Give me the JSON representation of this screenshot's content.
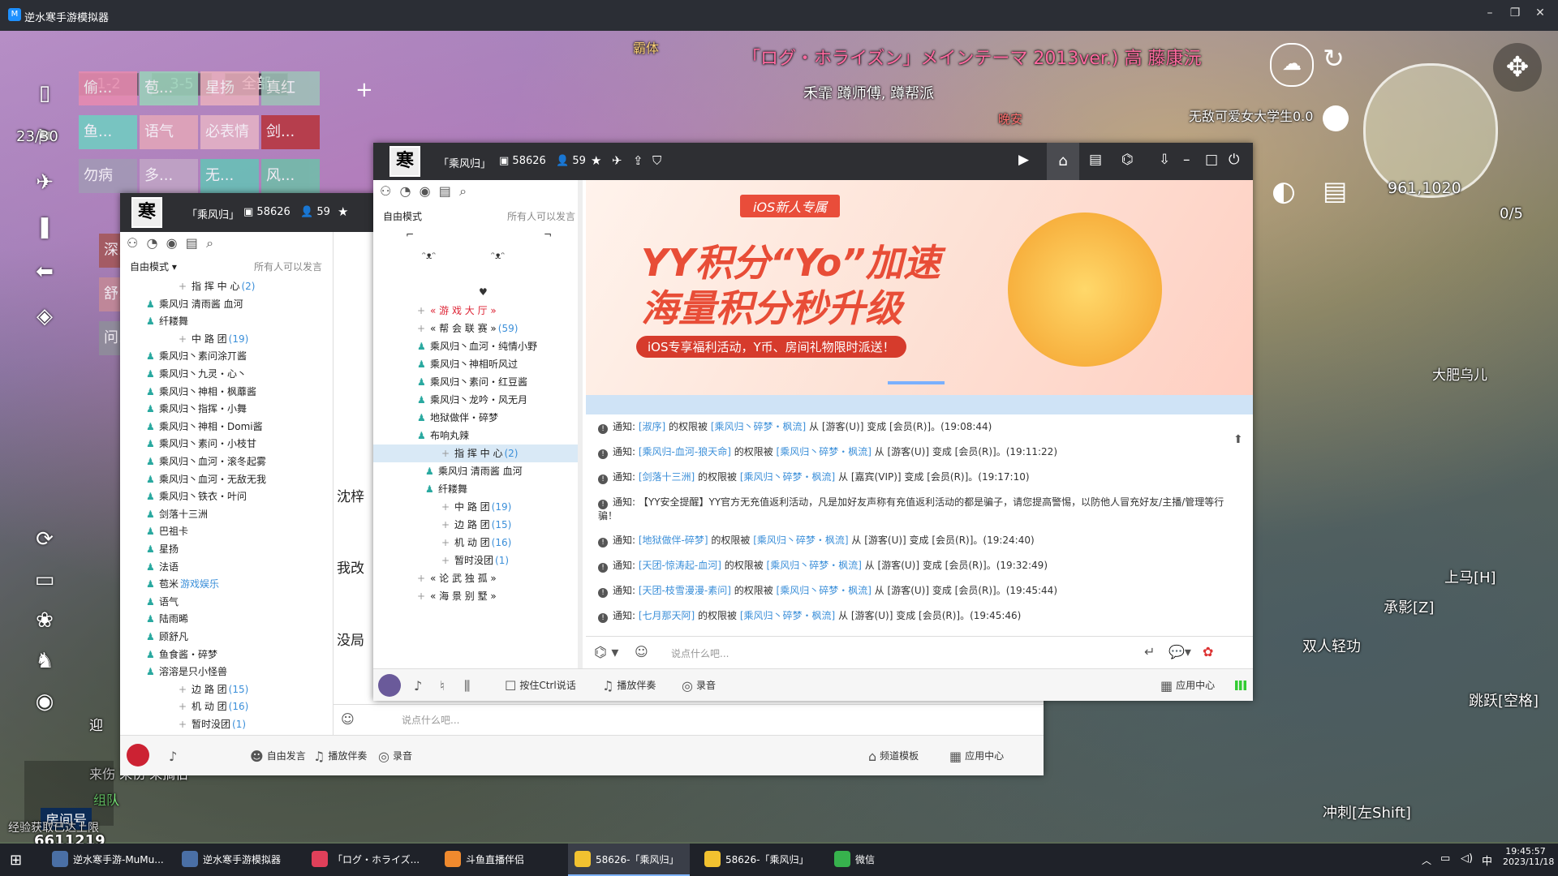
{
  "emulator": {
    "title": "逆水寒手游模拟器"
  },
  "game": {
    "team_tabs": [
      "1-2",
      "3-5",
      "全部"
    ],
    "team_counter": "23/30",
    "team_cells": [
      "偷...",
      "苞...",
      "星扬",
      "真红",
      "鱼...",
      "语气",
      "必表情",
      "剑...",
      "勿病",
      "多...",
      "无...",
      "风...",
      "深...",
      "",
      "舒...",
      "",
      "问..."
    ],
    "banner_top": "「ログ・ホライズン」メインテーマ 2013ver.) 高 藤康沅",
    "banner_sub": "禾霏 蹲师傅, 蹲帮派",
    "floating_names": [
      "霸体",
      "无敌可爱女大学生0.0",
      "大肥乌儿",
      "晚安"
    ],
    "coords": "961,1020",
    "quest_counter": "0/5",
    "skills": [
      "上马[H]",
      "承影[Z]",
      "双人轻功",
      "跳跃[空格]",
      "冲刺[左Shift]"
    ],
    "douyu_room_label": "房间号",
    "douyu_room_number": "6611219",
    "tip_text": "经验获取已达上限",
    "team_label": "组队",
    "left_chat": [
      "迎",
      "来伤 来伤 来摘伯"
    ]
  },
  "yy_back": {
    "channel_name": "「乘风归」",
    "channel_id": "58626",
    "user_count": "59",
    "mode": "自由模式",
    "permission": "所有人可以发言",
    "tree": [
      {
        "text": "指 挥 中 心",
        "count": "(2)",
        "indent": 1
      },
      {
        "text": "乘风归 清雨酱 血河",
        "count": "",
        "indent": 2
      },
      {
        "text": "纤耧舞",
        "count": "",
        "indent": 2
      },
      {
        "text": "中 路 团",
        "count": "(19)",
        "indent": 1
      },
      {
        "text": "乘风归丶素问涂丌酱",
        "count": "",
        "indent": 2
      },
      {
        "text": "乘风归丶九灵・心丶",
        "count": "",
        "indent": 2
      },
      {
        "text": "乘风归丶神相・枫蘼酱",
        "count": "",
        "indent": 2
      },
      {
        "text": "乘风归丶指挥・小舞",
        "count": "",
        "indent": 2
      },
      {
        "text": "乘风归丶神相・Domi酱",
        "count": "",
        "indent": 2
      },
      {
        "text": "乘风归丶素问・小枝甘",
        "count": "",
        "indent": 2
      },
      {
        "text": "乘风归丶血河・滚冬起雾",
        "count": "",
        "indent": 2
      },
      {
        "text": "乘风归丶血河・无敌无我",
        "count": "",
        "indent": 2
      },
      {
        "text": "乘风归丶铁衣・叶问",
        "count": "",
        "indent": 2
      },
      {
        "text": "剑落十三洲",
        "count": "",
        "indent": 2
      },
      {
        "text": "巴祖卡",
        "count": "",
        "indent": 2
      },
      {
        "text": "星扬",
        "count": "",
        "indent": 2
      },
      {
        "text": "法语",
        "count": "",
        "indent": 2
      },
      {
        "text": "苞米",
        "count": "游戏娱乐",
        "indent": 2
      },
      {
        "text": "语气",
        "count": "",
        "indent": 2
      },
      {
        "text": "陆雨晞",
        "count": "",
        "indent": 2
      },
      {
        "text": "顾舒凡",
        "count": "",
        "indent": 2
      },
      {
        "text": "鱼食酱・碎梦",
        "count": "",
        "indent": 2
      },
      {
        "text": "溶溶是只小怪兽",
        "count": "",
        "indent": 2
      },
      {
        "text": "边 路 团",
        "count": "(15)",
        "indent": 1
      },
      {
        "text": "机 动 团",
        "count": "(16)",
        "indent": 1
      },
      {
        "text": "暂时没团",
        "count": "(1)",
        "indent": 1
      }
    ],
    "chat_names": [
      "沈梓",
      "沈梓",
      "我改",
      "沈梓",
      "没局"
    ],
    "input_placeholder": "说点什么吧...",
    "toolbar": [
      "自由发言",
      "播放伴奏",
      "录音",
      "频道模板",
      "应用中心"
    ]
  },
  "yy_front": {
    "channel_name": "「乘风归」",
    "channel_id": "58626",
    "user_count": "59",
    "mode": "自由模式",
    "permission": "所有人可以发言",
    "tree": [
      {
        "text": "« 游 戏 大 厅 »",
        "count": "",
        "indent": 1,
        "red": true
      },
      {
        "text": "« 帮 会 联 赛 »",
        "count": "(59)",
        "indent": 1
      },
      {
        "text": "乘风归丶血河・纯情小野",
        "count": "",
        "indent": 2
      },
      {
        "text": "乘风归丶神相听风过",
        "count": "",
        "indent": 2
      },
      {
        "text": "乘风归丶素问・红豆酱",
        "count": "",
        "indent": 2
      },
      {
        "text": "乘风归丶龙吟・风无月",
        "count": "",
        "indent": 2
      },
      {
        "text": "地狱做伴・碎梦",
        "count": "",
        "indent": 2
      },
      {
        "text": "布响丸辣",
        "count": "",
        "indent": 2
      },
      {
        "text": "指 挥 中 心",
        "count": "(2)",
        "indent": 3,
        "selected": true
      },
      {
        "text": "乘风归 清雨酱 血河",
        "count": "",
        "indent": 4
      },
      {
        "text": "纤耧舞",
        "count": "",
        "indent": 4
      },
      {
        "text": "中 路 团",
        "count": "(19)",
        "indent": 3
      },
      {
        "text": "边 路 团",
        "count": "(15)",
        "indent": 3
      },
      {
        "text": "机 动 团",
        "count": "(16)",
        "indent": 3
      },
      {
        "text": "暂时没团",
        "count": "(1)",
        "indent": 3
      },
      {
        "text": "« 论 武 独 孤 »",
        "count": "",
        "indent": 1
      },
      {
        "text": "« 海 景 别 墅 »",
        "count": "",
        "indent": 1
      }
    ],
    "ad": {
      "badge": "iOS新人专属",
      "line1": "YY积分“Yo”加速",
      "line2": "海量积分秒升级",
      "tagline": "iOS专享福利活动，Y币、房间礼物限时派送！"
    },
    "notices": [
      {
        "pre": "通知: ",
        "name": "[淑序]",
        "mid": " 的权限被 ",
        "by": "[乘风归丶碎梦・枫流]",
        "post": " 从 [游客(U)] 变成 [会员(R)]。(19:08:44)"
      },
      {
        "pre": "通知: ",
        "name": "[乘风归-血河-狼天命]",
        "mid": " 的权限被 ",
        "by": "[乘风归丶碎梦・枫流]",
        "post": " 从 [游客(U)] 变成 [会员(R)]。(19:11:22)"
      },
      {
        "pre": "通知: ",
        "name": "[剑落十三洲]",
        "mid": " 的权限被 ",
        "by": "[乘风归丶碎梦・枫流]",
        "post": " 从 [嘉宾(VIP)] 变成 [会员(R)]。(19:17:10)"
      },
      {
        "pre": "通知: ",
        "name": "",
        "mid": "【YY安全提醒】YY官方无充值返利活动，凡是加好友声称有充值返利活动的都是骗子，请您提高警惕，以防他人冒充好友/主播/管理等行骗！",
        "by": "",
        "post": ""
      },
      {
        "pre": "通知: ",
        "name": "[地狱做伴-碎梦]",
        "mid": " 的权限被 ",
        "by": "[乘风归丶碎梦・枫流]",
        "post": " 从 [游客(U)] 变成 [会员(R)]。(19:24:40)"
      },
      {
        "pre": "通知: ",
        "name": "[天团-惊涛起-血河]",
        "mid": " 的权限被 ",
        "by": "[乘风归丶碎梦・枫流]",
        "post": " 从 [游客(U)] 变成 [会员(R)]。(19:32:49)"
      },
      {
        "pre": "通知: ",
        "name": "[天团-枝雪漫漫-素问]",
        "mid": " 的权限被 ",
        "by": "[乘风归丶碎梦・枫流]",
        "post": " 从 [游客(U)] 变成 [会员(R)]。(19:45:44)"
      },
      {
        "pre": "通知: ",
        "name": "[七月那天阿]",
        "mid": " 的权限被 ",
        "by": "[乘风归丶碎梦・枫流]",
        "post": " 从 [游客(U)] 变成 [会员(R)]。(19:45:46)"
      }
    ],
    "input_placeholder": "说点什么吧...",
    "toolbar": [
      "按住Ctrl说话",
      "播放伴奏",
      "录音",
      "应用中心"
    ]
  },
  "taskbar": {
    "items": [
      "逆水寒手游-MuMu...",
      "逆水寒手游模拟器",
      "「ログ・ホライズ...",
      "斗鱼直播伴侣",
      "58626-「乘风归」",
      "58626-「乘风归」",
      "微信"
    ],
    "active_index": 4,
    "tray_lang": "中",
    "time": "19:45:57",
    "date": "2023/11/18"
  }
}
